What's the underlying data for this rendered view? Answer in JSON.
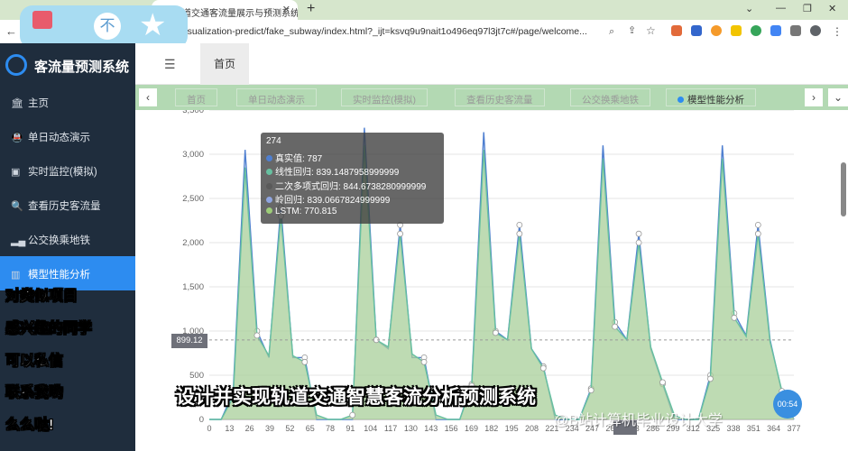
{
  "browser": {
    "tab_title": "道交通客流量展示与预测系统",
    "url": "visualization-predict/fake_subway/index.html?_ijt=ksvq9u9nait1o496eq97l3jt7c#/page/welcome...",
    "overlay_icon_label": "不"
  },
  "app": {
    "title": "客流量预测系统",
    "home_label": "首页"
  },
  "sidebar": {
    "items": [
      {
        "label": "主页",
        "icon": "bank-icon"
      },
      {
        "label": "单日动态演示",
        "icon": "train-icon"
      },
      {
        "label": "实时监控(模拟)",
        "icon": "monitor-icon"
      },
      {
        "label": "查看历史客流量",
        "icon": "search-icon"
      },
      {
        "label": "公交换乘地铁",
        "icon": "signal-icon"
      },
      {
        "label": "模型性能分析",
        "icon": "bar-chart-icon"
      }
    ]
  },
  "tags": [
    "首页",
    "单日动态演示",
    "实时监控(模拟)",
    "查看历史客流量",
    "公交换乘地铁",
    "模型性能分析"
  ],
  "tooltip": {
    "header": "274",
    "rows": [
      {
        "label": "真实值: 787",
        "color": "#4f7fd0"
      },
      {
        "label": "线性回归: 839.1487958999999",
        "color": "#67c0a0"
      },
      {
        "label": "二次多项式回归: 844.6738280999999",
        "color": "#5a5a5a"
      },
      {
        "label": "岭回归: 839.0667824999999",
        "color": "#8fa5e0"
      },
      {
        "label": "LSTM: 770.815",
        "color": "#9ccc78"
      }
    ]
  },
  "axis_pointer": {
    "y_value": "899.12"
  },
  "overlay": {
    "captions": [
      "对类似项目",
      "感兴趣的同学",
      "可以私信",
      "联系我哟",
      "么么哒!"
    ],
    "big_caption": "设计并实现轨道交通智慧客流分析预测系统",
    "watermark": "@B站计算机毕业设计大学",
    "timer": "00:54"
  },
  "chart_data": {
    "type": "area",
    "x": [
      "0",
      "13",
      "26",
      "39",
      "52",
      "65",
      "78",
      "91",
      "104",
      "117",
      "130",
      "143",
      "156",
      "169",
      "182",
      "195",
      "208",
      "221",
      "234",
      "247",
      "260",
      "273",
      "286",
      "299",
      "312",
      "325",
      "338",
      "351",
      "364",
      "377"
    ],
    "ylim": [
      0,
      3500
    ],
    "yticks": [
      500,
      1000,
      1500,
      2000,
      2500,
      3000,
      3500
    ],
    "series": [
      {
        "name": "真实值",
        "color": "#4f7fd0",
        "values": [
          0,
          0,
          300,
          3050,
          1000,
          700,
          2400,
          700,
          700,
          0,
          0,
          0,
          0,
          3300,
          900,
          800,
          2200,
          700,
          700,
          0,
          0,
          0,
          400,
          3250,
          1000,
          900,
          2200,
          800,
          600,
          0,
          0,
          0,
          350,
          3100,
          1100,
          900,
          2100,
          800,
          400,
          0,
          0,
          0,
          500,
          3100,
          1200,
          950,
          2200,
          900,
          300,
          0
        ]
      },
      {
        "name": "线性回归",
        "color": "#67c0a0",
        "values": [
          0,
          0,
          250,
          2850,
          950,
          720,
          2300,
          720,
          650,
          50,
          0,
          0,
          50,
          3100,
          900,
          820,
          2100,
          740,
          650,
          50,
          0,
          0,
          380,
          3050,
          980,
          900,
          2100,
          800,
          580,
          50,
          0,
          0,
          330,
          2950,
          1050,
          900,
          2000,
          820,
          420,
          40,
          0,
          0,
          460,
          2950,
          1150,
          940,
          2100,
          880,
          320,
          30
        ]
      }
    ]
  }
}
